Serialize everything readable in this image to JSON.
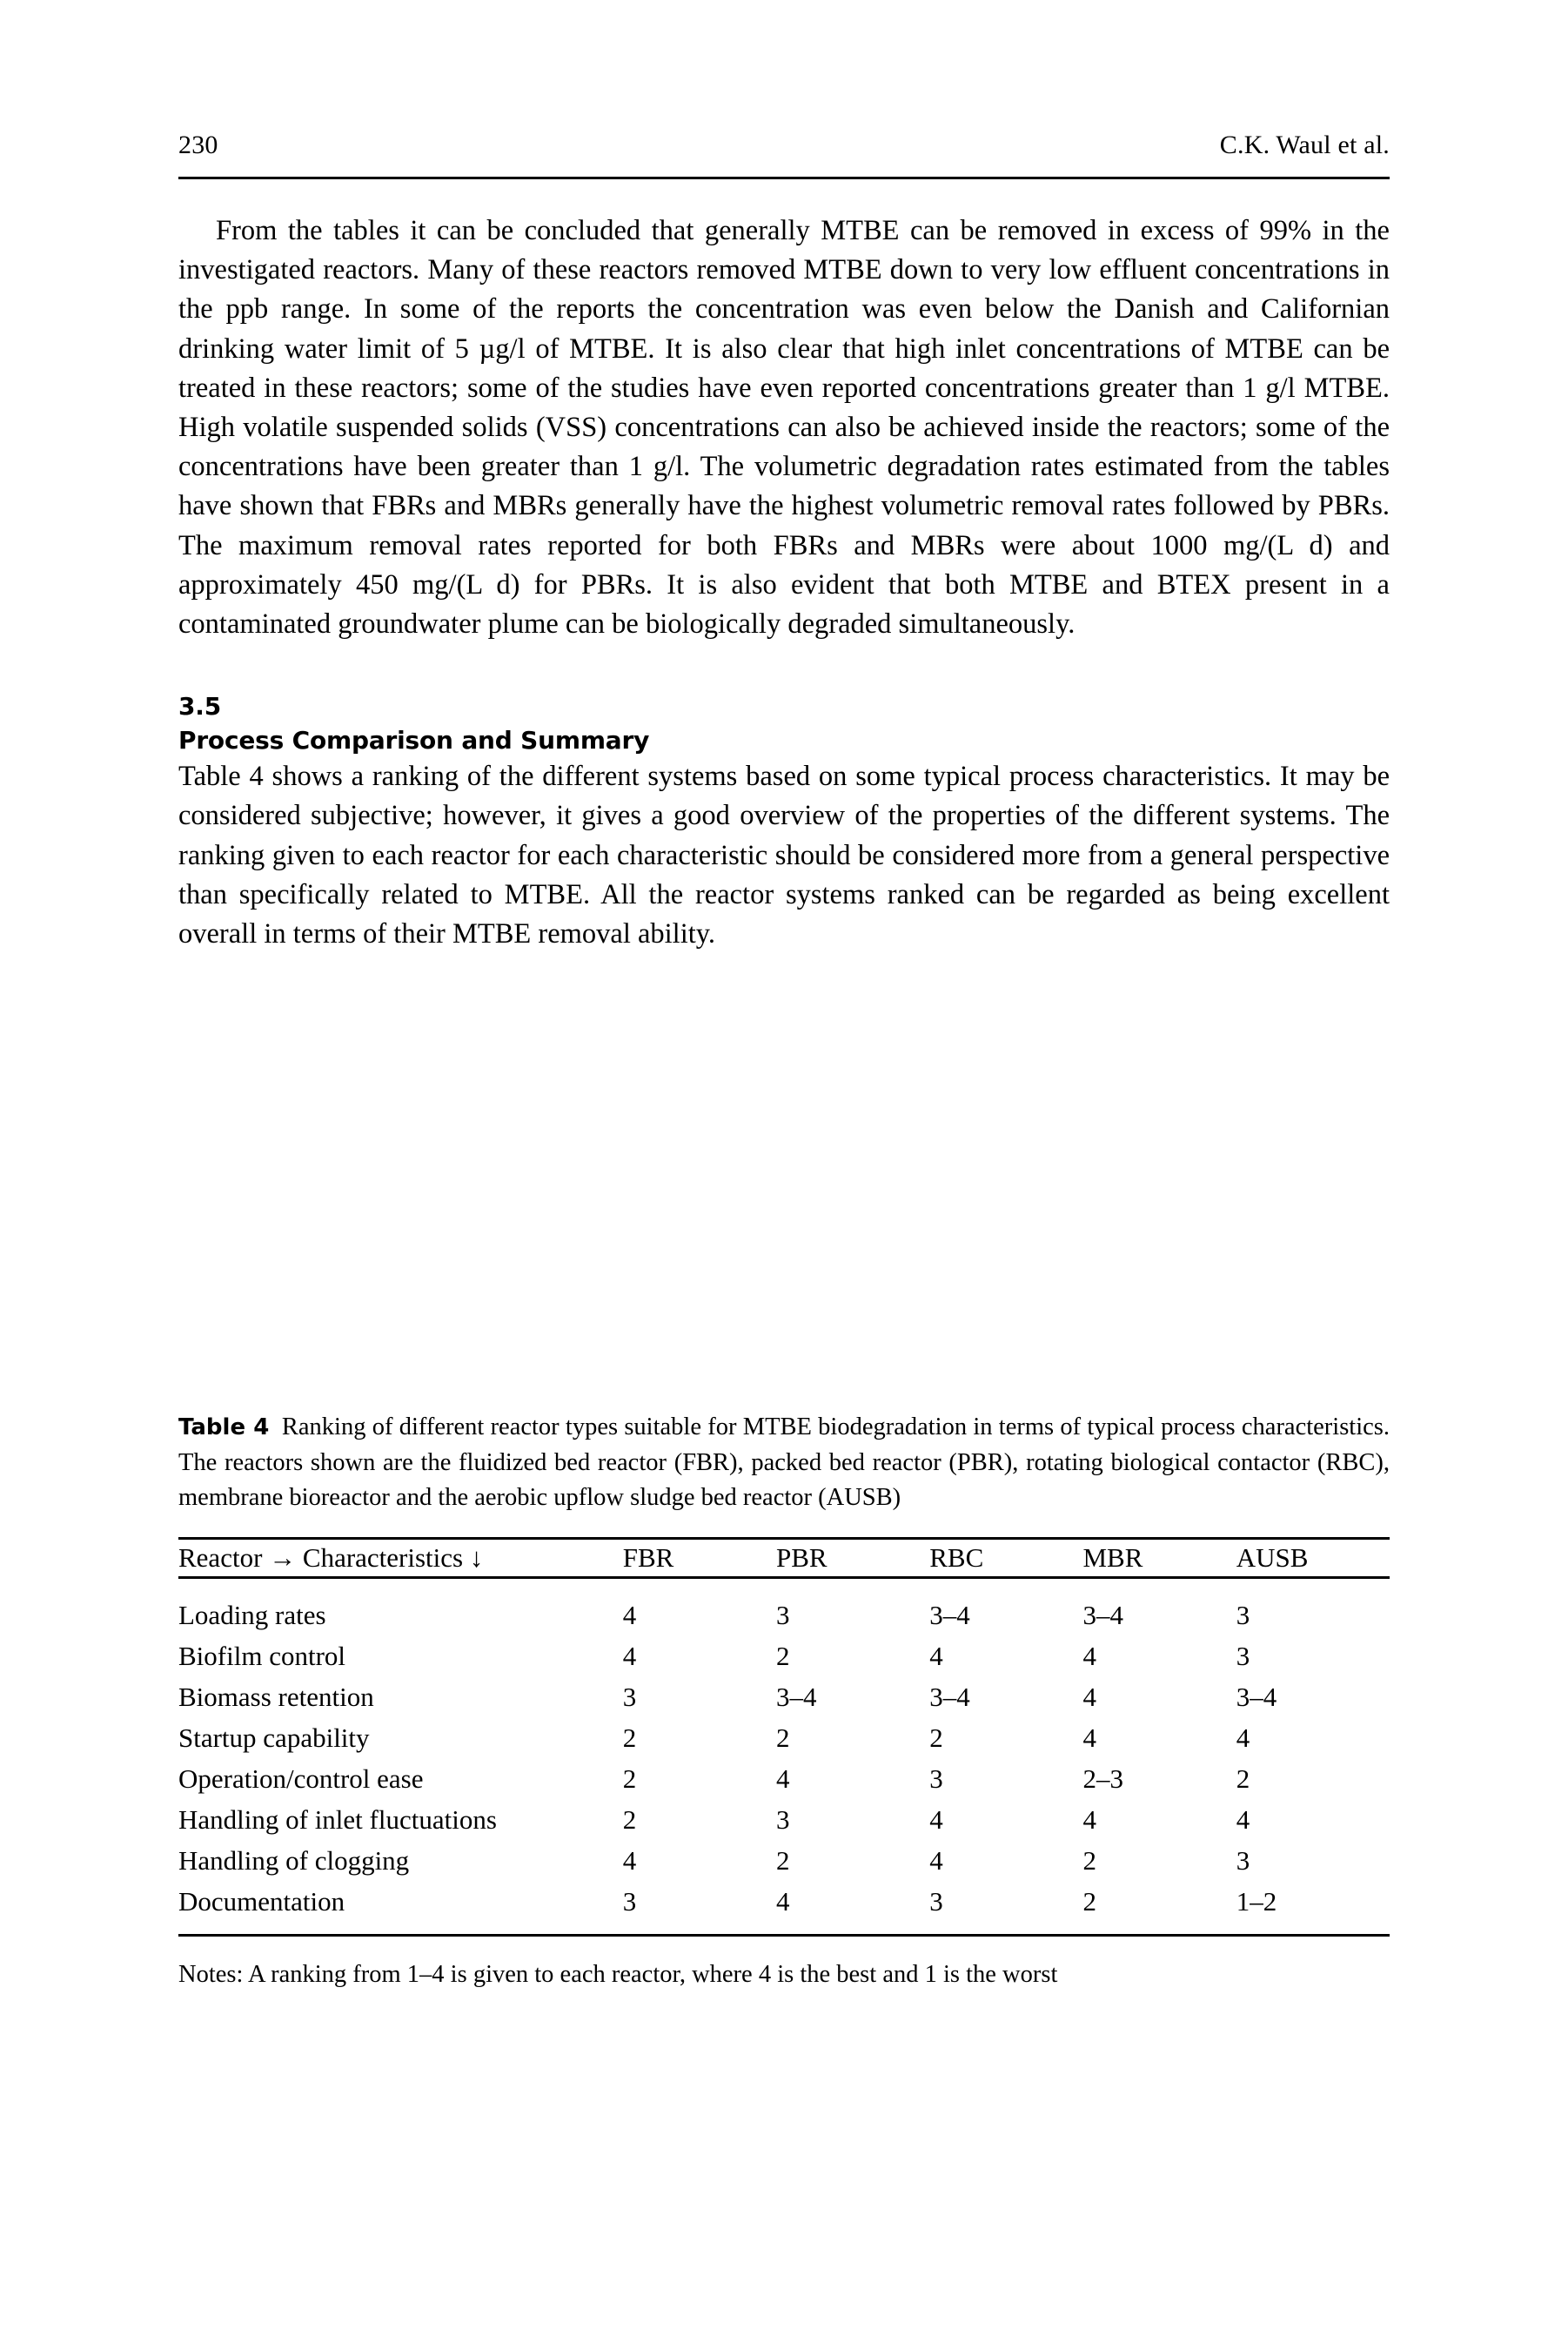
{
  "running_head": {
    "folio": "230",
    "authors": "C.K. Waul et al."
  },
  "paragraphs": [
    "From the tables it can be concluded that generally MTBE can be removed in excess of 99% in the investigated reactors. Many of these reactors removed MTBE down to very low effluent concentrations in the ppb range. In some of the reports the concentration was even below the Danish and Californian drinking water limit of 5 µg/l of MTBE. It is also clear that high inlet concentrations of MTBE can be treated in these reactors; some of the studies have even reported concentrations greater than 1 g/l MTBE. High volatile suspended solids (VSS) concentrations can also be achieved inside the reactors; some of the concentrations have been greater than 1 g/l. The volumetric degradation rates estimated from the tables have shown that FBRs and MBRs generally have the highest volumetric removal rates followed by PBRs. The maximum removal rates reported for both FBRs and MBRs were about 1000 mg/(L d) and approximately 450 mg/(L d) for PBRs. It is also evident that both MTBE and BTEX present in a contaminated groundwater plume can be biologically degraded simultaneously.",
    "Table 4 shows a ranking of the different systems based on some typical process characteristics. It may be considered subjective; however, it gives a good overview of the properties of the different systems. The ranking given to each reactor for each characteristic should be considered more from a general perspective than specifically related to MTBE. All the reactor systems ranked can be regarded as being excellent overall in terms of their MTBE removal ability."
  ],
  "section": {
    "number": "3.5",
    "title": "Process Comparison and Summary"
  },
  "table": {
    "label": "Table 4",
    "caption": "Ranking of different reactor types suitable for MTBE biodegradation in terms of typical process characteristics. The reactors shown are the fluidized bed reactor (FBR), packed bed reactor (PBR), rotating biological contactor (RBC), membrane bioreactor and the aerobic upflow sludge bed reactor (AUSB)",
    "stub_header_line1": "Reactor →",
    "stub_header_line2": "Characteristics ↓",
    "columns": [
      "FBR",
      "PBR",
      "RBC",
      "MBR",
      "AUSB"
    ],
    "rows": [
      {
        "characteristic": "Loading rates",
        "values": [
          "4",
          "3",
          "3–4",
          "3–4",
          "3"
        ]
      },
      {
        "characteristic": "Biofilm control",
        "values": [
          "4",
          "2",
          "4",
          "4",
          "3"
        ]
      },
      {
        "characteristic": "Biomass retention",
        "values": [
          "3",
          "3–4",
          "3–4",
          "4",
          "3–4"
        ]
      },
      {
        "characteristic": "Startup capability",
        "values": [
          "2",
          "2",
          "2",
          "4",
          "4"
        ]
      },
      {
        "characteristic": "Operation/control ease",
        "values": [
          "2",
          "4",
          "3",
          "2–3",
          "2"
        ]
      },
      {
        "characteristic": "Handling of inlet fluctuations",
        "values": [
          "2",
          "3",
          "4",
          "4",
          "4"
        ]
      },
      {
        "characteristic": "Handling of clogging",
        "values": [
          "4",
          "2",
          "4",
          "2",
          "3"
        ]
      },
      {
        "characteristic": "Documentation",
        "values": [
          "3",
          "4",
          "3",
          "2",
          "1–2"
        ]
      }
    ],
    "notes": "Notes: A ranking from 1–4 is given to each reactor, where 4 is the best and 1 is the worst"
  }
}
